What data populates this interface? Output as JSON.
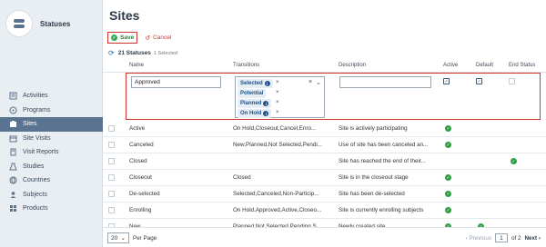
{
  "app": {
    "title": "Statuses"
  },
  "sidebar": {
    "items": [
      {
        "label": "Activities",
        "icon": "activities-icon",
        "active": false
      },
      {
        "label": "Programs",
        "icon": "programs-icon",
        "active": false
      },
      {
        "label": "Sites",
        "icon": "sites-icon",
        "active": true
      },
      {
        "label": "Site Visits",
        "icon": "site-visits-icon",
        "active": false
      },
      {
        "label": "Visit Reports",
        "icon": "visit-reports-icon",
        "active": false
      },
      {
        "label": "Studies",
        "icon": "studies-icon",
        "active": false
      },
      {
        "label": "Countries",
        "icon": "globe-icon",
        "active": false
      },
      {
        "label": "Subjects",
        "icon": "subjects-icon",
        "active": false
      },
      {
        "label": "Products",
        "icon": "products-icon",
        "active": false
      }
    ]
  },
  "page": {
    "title": "Sites"
  },
  "toolbar": {
    "save_label": "Save",
    "cancel_label": "Cancel"
  },
  "summary": {
    "count": "21 Statuses",
    "selected": "1 Selected"
  },
  "columns": {
    "name": "Name",
    "transitions": "Transitions",
    "description": "Description",
    "active": "Active",
    "default": "Default",
    "end_status": "End Status"
  },
  "edit_row": {
    "name_value": "Approved",
    "description_value": "",
    "chips": [
      "Selected",
      "Potential",
      "Planned",
      "On Hold"
    ],
    "active_checked": true,
    "default_checked": true,
    "end_status_checked": false
  },
  "rows": [
    {
      "name": "Active",
      "transitions": "On Hold,Closeout,Cancel,Enro...",
      "description": "Site is actively participating",
      "active": true,
      "default": false,
      "end": false
    },
    {
      "name": "Canceled",
      "transitions": "New,Planned,Not Selected,Pendi...",
      "description": "Use of site has been canceled an...",
      "active": true,
      "default": false,
      "end": false
    },
    {
      "name": "Closed",
      "transitions": "",
      "description": "Site has reached the end of their...",
      "active": false,
      "default": false,
      "end": true
    },
    {
      "name": "Closeout",
      "transitions": "Closed",
      "description": "Site is in the closeout stage",
      "active": true,
      "default": false,
      "end": false
    },
    {
      "name": "De-selected",
      "transitions": "Selected,Canceled,Non-Particip...",
      "description": "Site has been de-selected",
      "active": true,
      "default": false,
      "end": false
    },
    {
      "name": "Enrolling",
      "transitions": "On Hold,Approved,Active,Closeo...",
      "description": "Site is currently enrolling subjects",
      "active": true,
      "default": false,
      "end": false
    },
    {
      "name": "New",
      "transitions": "Planned,Not Selected,Pending,S...",
      "description": "Newly created site",
      "active": true,
      "default": true,
      "end": false
    }
  ],
  "footer": {
    "per_page_value": "20",
    "per_page_label": "Per Page",
    "previous_label": "Previous",
    "page_value": "1",
    "of_label": "of 2",
    "next_label": "Next"
  },
  "colors": {
    "accent_red": "#d0342c",
    "active_nav": "#5a7390",
    "status_green": "#2e9e44",
    "link_blue": "#2b6cb0"
  }
}
